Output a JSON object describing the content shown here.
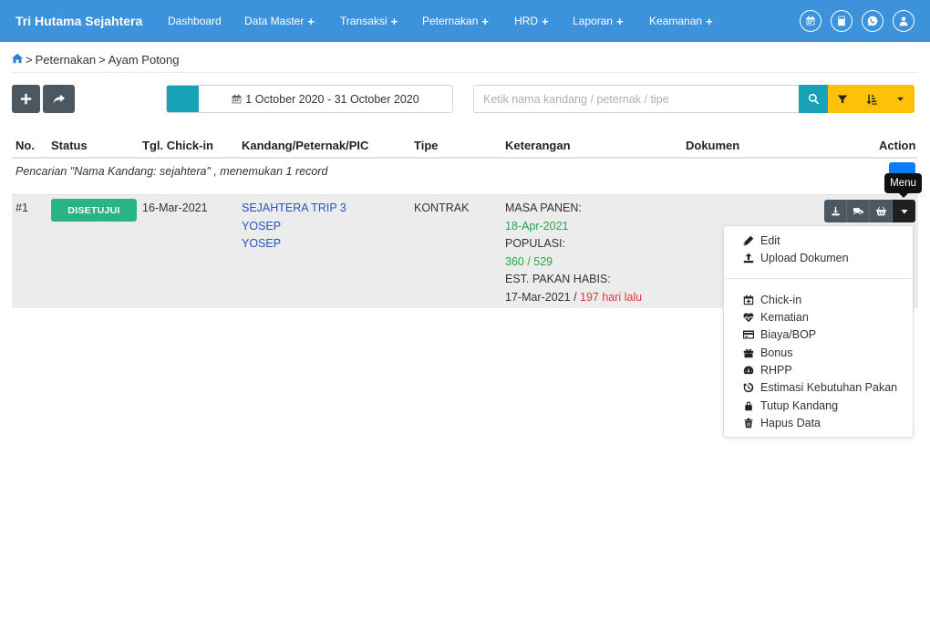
{
  "navbar": {
    "brand": "Tri Hutama Sejahtera",
    "items": [
      {
        "label": "Dashboard",
        "plus": ""
      },
      {
        "label": "Data Master",
        "plus": "+"
      },
      {
        "label": "Transaksi",
        "plus": "+"
      },
      {
        "label": "Peternakan",
        "plus": "+"
      },
      {
        "label": "HRD",
        "plus": "+"
      },
      {
        "label": "Laporan",
        "plus": "+"
      },
      {
        "label": "Keamanan",
        "plus": "+"
      }
    ],
    "icons": [
      "calendar-icon",
      "calculator-icon",
      "whatsapp-icon",
      "user-icon"
    ]
  },
  "breadcrumb": {
    "items": [
      "Peternakan",
      "Ayam Potong"
    ],
    "separator": ">"
  },
  "toolbar": {
    "date_range": "1 October 2020 - 31 October 2020",
    "search_placeholder": "Ketik nama kandang / peternak / tipe"
  },
  "table": {
    "headers": [
      "No.",
      "Status",
      "Tgl. Chick-in",
      "Kandang/Peternak/PIC",
      "Tipe",
      "Keterangan",
      "Dokumen",
      "Action"
    ],
    "info": "Pencarian \"Nama Kandang: sejahtera\" , menemukan 1 record",
    "rows": [
      {
        "no": "#1",
        "status": "DISETUJUI",
        "chickin": "16-Mar-2021",
        "kandang": "SEJAHTERA TRIP 3",
        "peternak": "YOSEP",
        "pic": "YOSEP",
        "tipe": "KONTRAK",
        "masa_panen_label": "MASA PANEN:",
        "masa_panen_value": "18-Apr-2021",
        "populasi_label": "POPULASI:",
        "populasi_value": "360 / 529",
        "est_pakan_label": "EST. PAKAN HABIS:",
        "est_pakan_date": "17-Mar-2021",
        "est_pakan_sep": "/",
        "est_pakan_ago": "197 hari lalu"
      }
    ]
  },
  "tooltip": "Menu",
  "dropdown": {
    "items": [
      {
        "label": "Edit",
        "icon": "pencil-icon"
      },
      {
        "label": "Upload Dokumen",
        "icon": "upload-icon"
      },
      {
        "label": "Chick-in",
        "icon": "calendar-plus-icon"
      },
      {
        "label": "Kematian",
        "icon": "heartbeat-icon"
      },
      {
        "label": "Biaya/BOP",
        "icon": "credit-card-icon"
      },
      {
        "label": "Bonus",
        "icon": "gift-icon"
      },
      {
        "label": "RHPP",
        "icon": "dashboard-icon"
      },
      {
        "label": "Estimasi Kebutuhan Pakan",
        "icon": "history-icon"
      },
      {
        "label": "Tutup Kandang",
        "icon": "lock-icon"
      },
      {
        "label": "Hapus Data",
        "icon": "trash-icon"
      }
    ]
  },
  "colors": {
    "navbar": "#3d92dc",
    "success_badge": "#28b487",
    "info": "#17a2b8",
    "warning": "#ffc107",
    "dark_button": "#4b5761",
    "link": "#2453c9"
  }
}
